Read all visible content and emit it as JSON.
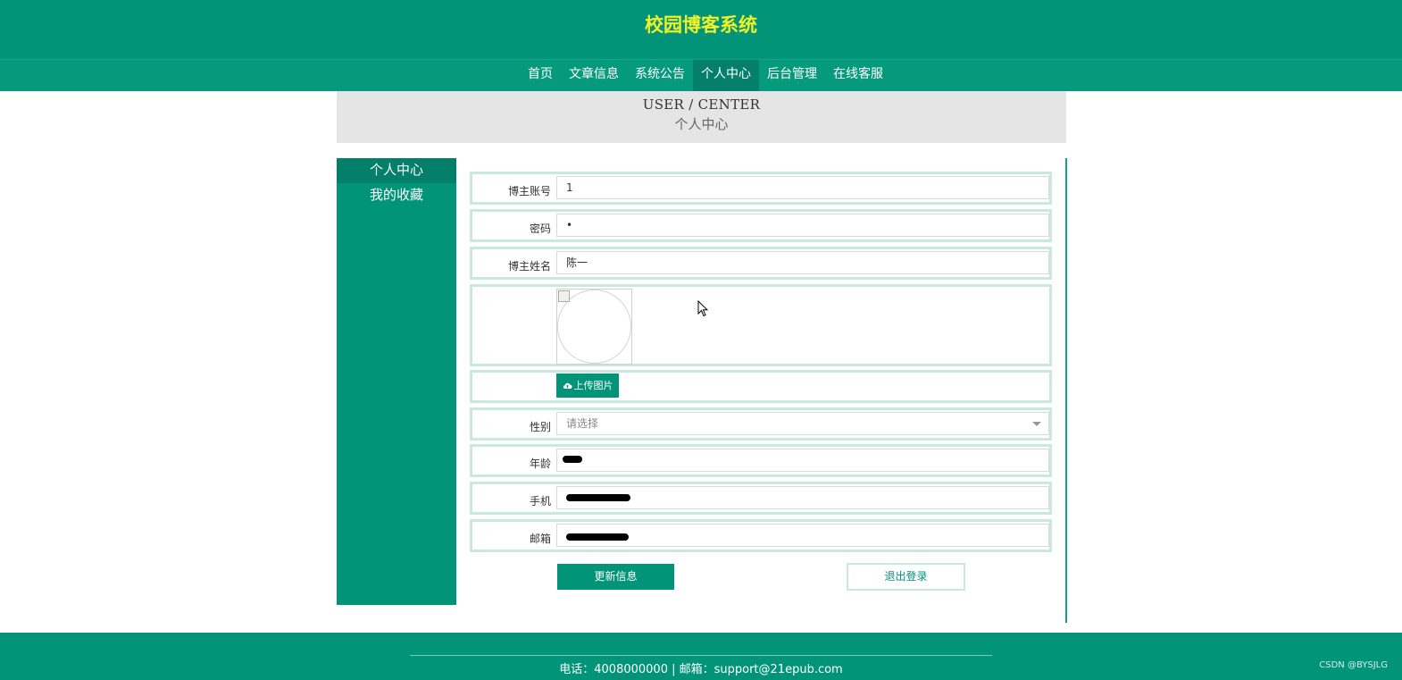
{
  "header": {
    "title": "校园博客系统"
  },
  "nav": {
    "items": [
      {
        "label": "首页"
      },
      {
        "label": "文章信息"
      },
      {
        "label": "系统公告"
      },
      {
        "label": "个人中心"
      },
      {
        "label": "后台管理"
      },
      {
        "label": "在线客服"
      }
    ],
    "active": "个人中心"
  },
  "banner": {
    "en": "USER / CENTER",
    "cn": "个人中心"
  },
  "sidebar": {
    "items": [
      {
        "label": "个人中心"
      },
      {
        "label": "我的收藏"
      }
    ]
  },
  "form": {
    "account": {
      "label": "博主账号",
      "value": "1"
    },
    "password": {
      "label": "密码",
      "value": "•"
    },
    "name": {
      "label": "博主姓名",
      "value": "陈一"
    },
    "upload_label": "上传图片",
    "gender": {
      "label": "性别",
      "placeholder": "请选择"
    },
    "age": {
      "label": "年龄"
    },
    "phone": {
      "label": "手机"
    },
    "email": {
      "label": "邮箱"
    }
  },
  "buttons": {
    "update": "更新信息",
    "logout": "退出登录"
  },
  "footer": {
    "text": "电话：4008000000 | 邮箱：support@21epub.com",
    "watermark": "CSDN @BYSJLG"
  },
  "colors": {
    "primary": "#019478",
    "active": "#04806a",
    "title": "#f1f12a",
    "row_border": "#c9e9df"
  }
}
